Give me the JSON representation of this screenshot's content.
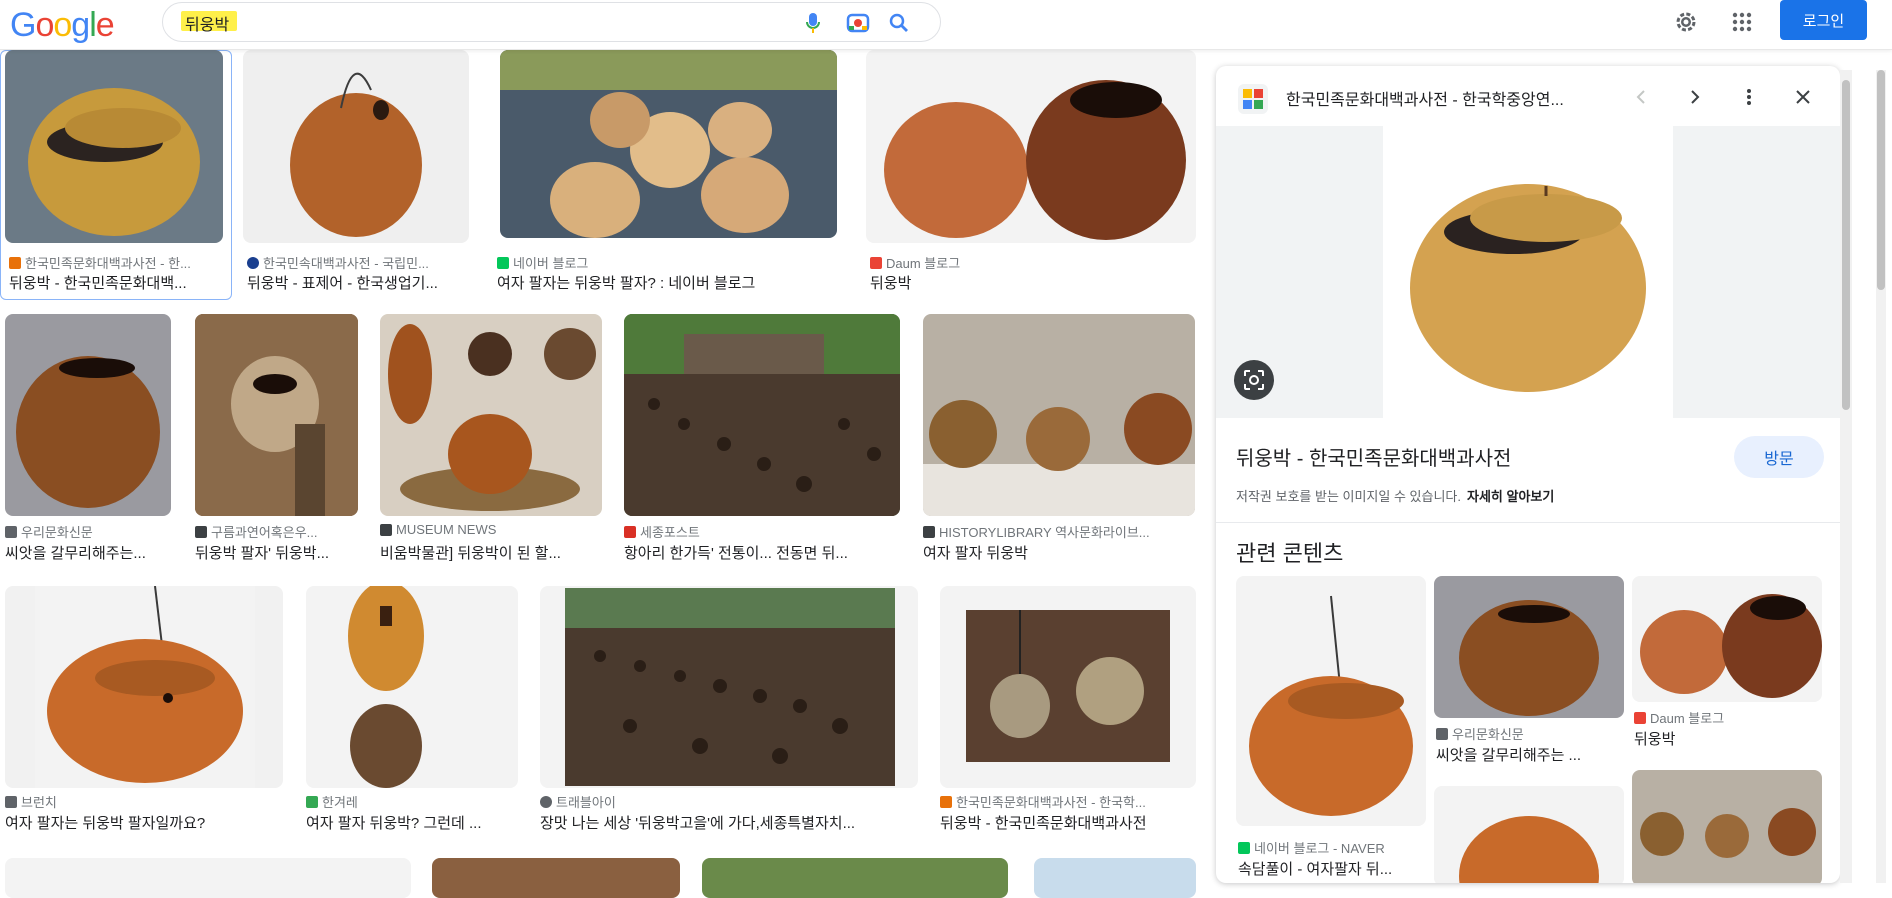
{
  "header": {
    "logo_letters": [
      {
        "ch": "G",
        "color": "#4285f4"
      },
      {
        "ch": "o",
        "color": "#ea4335"
      },
      {
        "ch": "o",
        "color": "#fbbc05"
      },
      {
        "ch": "g",
        "color": "#4285f4"
      },
      {
        "ch": "l",
        "color": "#34a853"
      },
      {
        "ch": "e",
        "color": "#ea4335"
      }
    ],
    "search_value": "뒤웅박",
    "icons": [
      "microphone-icon",
      "camera-lens-icon",
      "search-icon",
      "gear-icon",
      "apps-grid-icon"
    ],
    "login_label": "로그인",
    "accent": "#1a73e8"
  },
  "results": [
    {
      "source": "한국민족문화대백과사전 - 한...",
      "title": "뒤웅박 - 한국민족문화대백...",
      "fav": "#e8710a"
    },
    {
      "source": "한국민속대백과사전 - 국립민...",
      "title": "뒤웅박 - 표제어 - 한국생업기...",
      "fav": "#1a3f8f"
    },
    {
      "source": "네이버 블로그",
      "title": "여자 팔자는 뒤웅박 팔자? : 네이버 블로그",
      "fav": "#03c75a"
    },
    {
      "source": "Daum 블로그",
      "title": "뒤웅박",
      "fav": "#ea4335"
    },
    {
      "source": "우리문화신문",
      "title": "씨앗을 갈무리해주는...",
      "fav": "#5f6368"
    },
    {
      "source": "구름과연어혹은우...",
      "title": "뒤웅박 팔자' 뒤웅박...",
      "fav": "#3c4043"
    },
    {
      "source": "MUSEUM NEWS",
      "title": "비움박물관] 뒤웅박이 된 할...",
      "fav": "#3c4043"
    },
    {
      "source": "세종포스트",
      "title": "항아리 한가득' 전통이... 전동면 뒤...",
      "fav": "#d93025"
    },
    {
      "source": "HISTORYLIBRARY 역사문화라이브...",
      "title": "여자 팔자 뒤웅박",
      "fav": "#3c4043"
    },
    {
      "source": "브런치",
      "title": "여자 팔자는 뒤웅박 팔자일까요?",
      "fav": "#5f6368"
    },
    {
      "source": "한겨레",
      "title": "여자 팔자 뒤웅박? 그런데 ...",
      "fav": "#34a853"
    },
    {
      "source": "트래블아이",
      "title": "장맛 나는 세상 '뒤웅박고을'에 가다,세종특별자치...",
      "fav": "#5f6368"
    },
    {
      "source": "한국민족문화대백과사전 - 한국학...",
      "title": "뒤웅박 - 한국민족문화대백과사전",
      "fav": "#e8710a"
    }
  ],
  "panel": {
    "source": "한국민족문화대백과사전 - 한국학중앙연...",
    "title": "뒤웅박 - 한국민족문화대백과사전",
    "visit_label": "방문",
    "copyright_note": "저작권 보호를 받는 이미지일 수 있습니다.",
    "learn_more": "자세히 알아보기",
    "related_heading": "관련 콘텐츠",
    "related": [
      {
        "source": "네이버 블로그 - NAVER",
        "title": "속담풀이 - 여자팔자 뒤...",
        "fav": "#03c75a"
      },
      {
        "source": "우리문화신문",
        "title": "씨앗을 갈무리해주는 ...",
        "fav": "#5f6368"
      },
      {
        "source": "Daum 블로그",
        "title": "뒤웅박",
        "fav": "#ea4335"
      }
    ]
  }
}
